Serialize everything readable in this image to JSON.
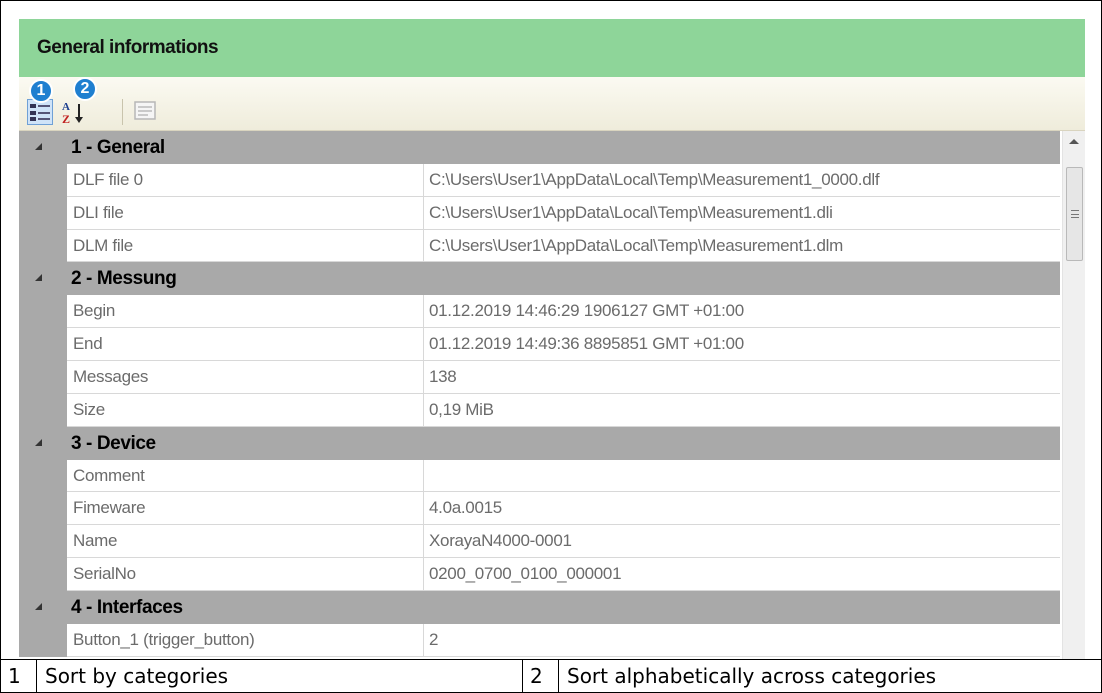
{
  "panel": {
    "title": "General informations"
  },
  "toolbar": {
    "badges": [
      "1",
      "2"
    ]
  },
  "grid": {
    "categories": [
      {
        "label": "1 - General",
        "rows": [
          {
            "name": "DLF file 0",
            "value": "C:\\Users\\User1\\AppData\\Local\\Temp\\Measurement1_0000.dlf"
          },
          {
            "name": "DLI file",
            "value": "C:\\Users\\User1\\AppData\\Local\\Temp\\Measurement1.dli"
          },
          {
            "name": "DLM file",
            "value": "C:\\Users\\User1\\AppData\\Local\\Temp\\Measurement1.dlm"
          }
        ]
      },
      {
        "label": "2 - Messung",
        "rows": [
          {
            "name": "Begin",
            "value": "01.12.2019  14:46:29  1906127  GMT +01:00"
          },
          {
            "name": "End",
            "value": "01.12.2019  14:49:36  8895851  GMT +01:00"
          },
          {
            "name": "Messages",
            "value": "138"
          },
          {
            "name": "Size",
            "value": "0,19 MiB"
          }
        ]
      },
      {
        "label": "3 - Device",
        "rows": [
          {
            "name": "Comment",
            "value": ""
          },
          {
            "name": "Fimeware",
            "value": "4.0a.0015"
          },
          {
            "name": "Name",
            "value": "XorayaN4000-0001"
          },
          {
            "name": "SerialNo",
            "value": "0200_0700_0100_000001"
          }
        ]
      },
      {
        "label": "4 - Interfaces",
        "rows": [
          {
            "name": "Button_1 (trigger_button)",
            "value": "2"
          }
        ]
      }
    ]
  },
  "legend": [
    {
      "num": "1",
      "text": "Sort by categories"
    },
    {
      "num": "2",
      "text": "Sort alphabetically across categories"
    }
  ]
}
